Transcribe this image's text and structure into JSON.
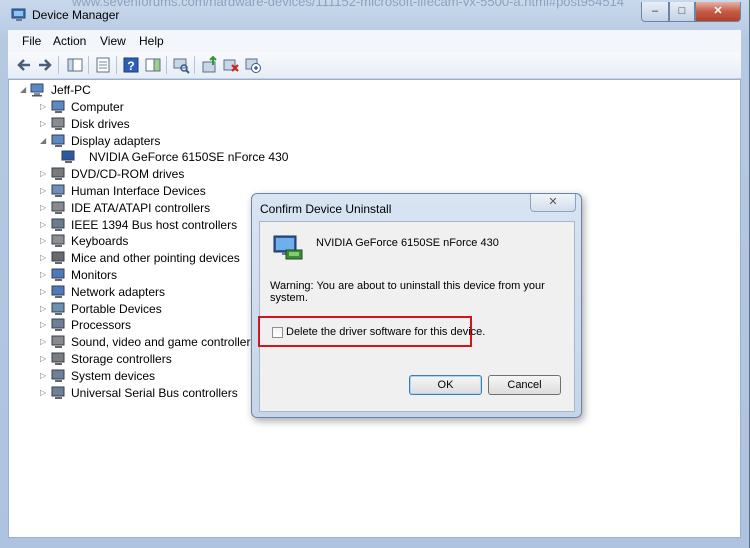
{
  "window": {
    "title": "Device Manager",
    "background_url": "www.sevenforums.com/hardware-devices/111152-microsoft-lifecam-vx-5500-a.html#post954514"
  },
  "menu": [
    "File",
    "Action",
    "View",
    "Help"
  ],
  "toolbar_icons": [
    "back-icon",
    "forward-icon",
    "show-hide-console-tree-icon",
    "properties-icon",
    "help-icon",
    "action-pane-icon",
    "scan-hardware-icon",
    "update-driver-icon",
    "uninstall-icon",
    "enable-device-icon"
  ],
  "tree": {
    "root": "Jeff-PC",
    "items": [
      {
        "label": "Computer",
        "expanded": false
      },
      {
        "label": "Disk drives",
        "expanded": false
      },
      {
        "label": "Display adapters",
        "expanded": true
      },
      {
        "label": "NVIDIA GeForce 6150SE nForce 430",
        "child": true
      },
      {
        "label": "DVD/CD-ROM drives",
        "expanded": false
      },
      {
        "label": "Human Interface Devices",
        "expanded": false
      },
      {
        "label": "IDE ATA/ATAPI controllers",
        "expanded": false
      },
      {
        "label": "IEEE 1394 Bus host controllers",
        "expanded": false
      },
      {
        "label": "Keyboards",
        "expanded": false
      },
      {
        "label": "Mice and other pointing devices",
        "expanded": false
      },
      {
        "label": "Monitors",
        "expanded": false
      },
      {
        "label": "Network adapters",
        "expanded": false
      },
      {
        "label": "Portable Devices",
        "expanded": false
      },
      {
        "label": "Processors",
        "expanded": false
      },
      {
        "label": "Sound, video and game controllers",
        "expanded": false
      },
      {
        "label": "Storage controllers",
        "expanded": false
      },
      {
        "label": "System devices",
        "expanded": false
      },
      {
        "label": "Universal Serial Bus controllers",
        "expanded": false
      }
    ]
  },
  "dialog": {
    "title": "Confirm Device Uninstall",
    "device_name": "NVIDIA GeForce 6150SE nForce 430",
    "warning": "Warning: You are about to uninstall this device from your system.",
    "checkbox_label": "Delete the driver software for this device.",
    "checkbox_checked": false,
    "ok": "OK",
    "cancel": "Cancel",
    "highlight_color": "#d4141c"
  }
}
